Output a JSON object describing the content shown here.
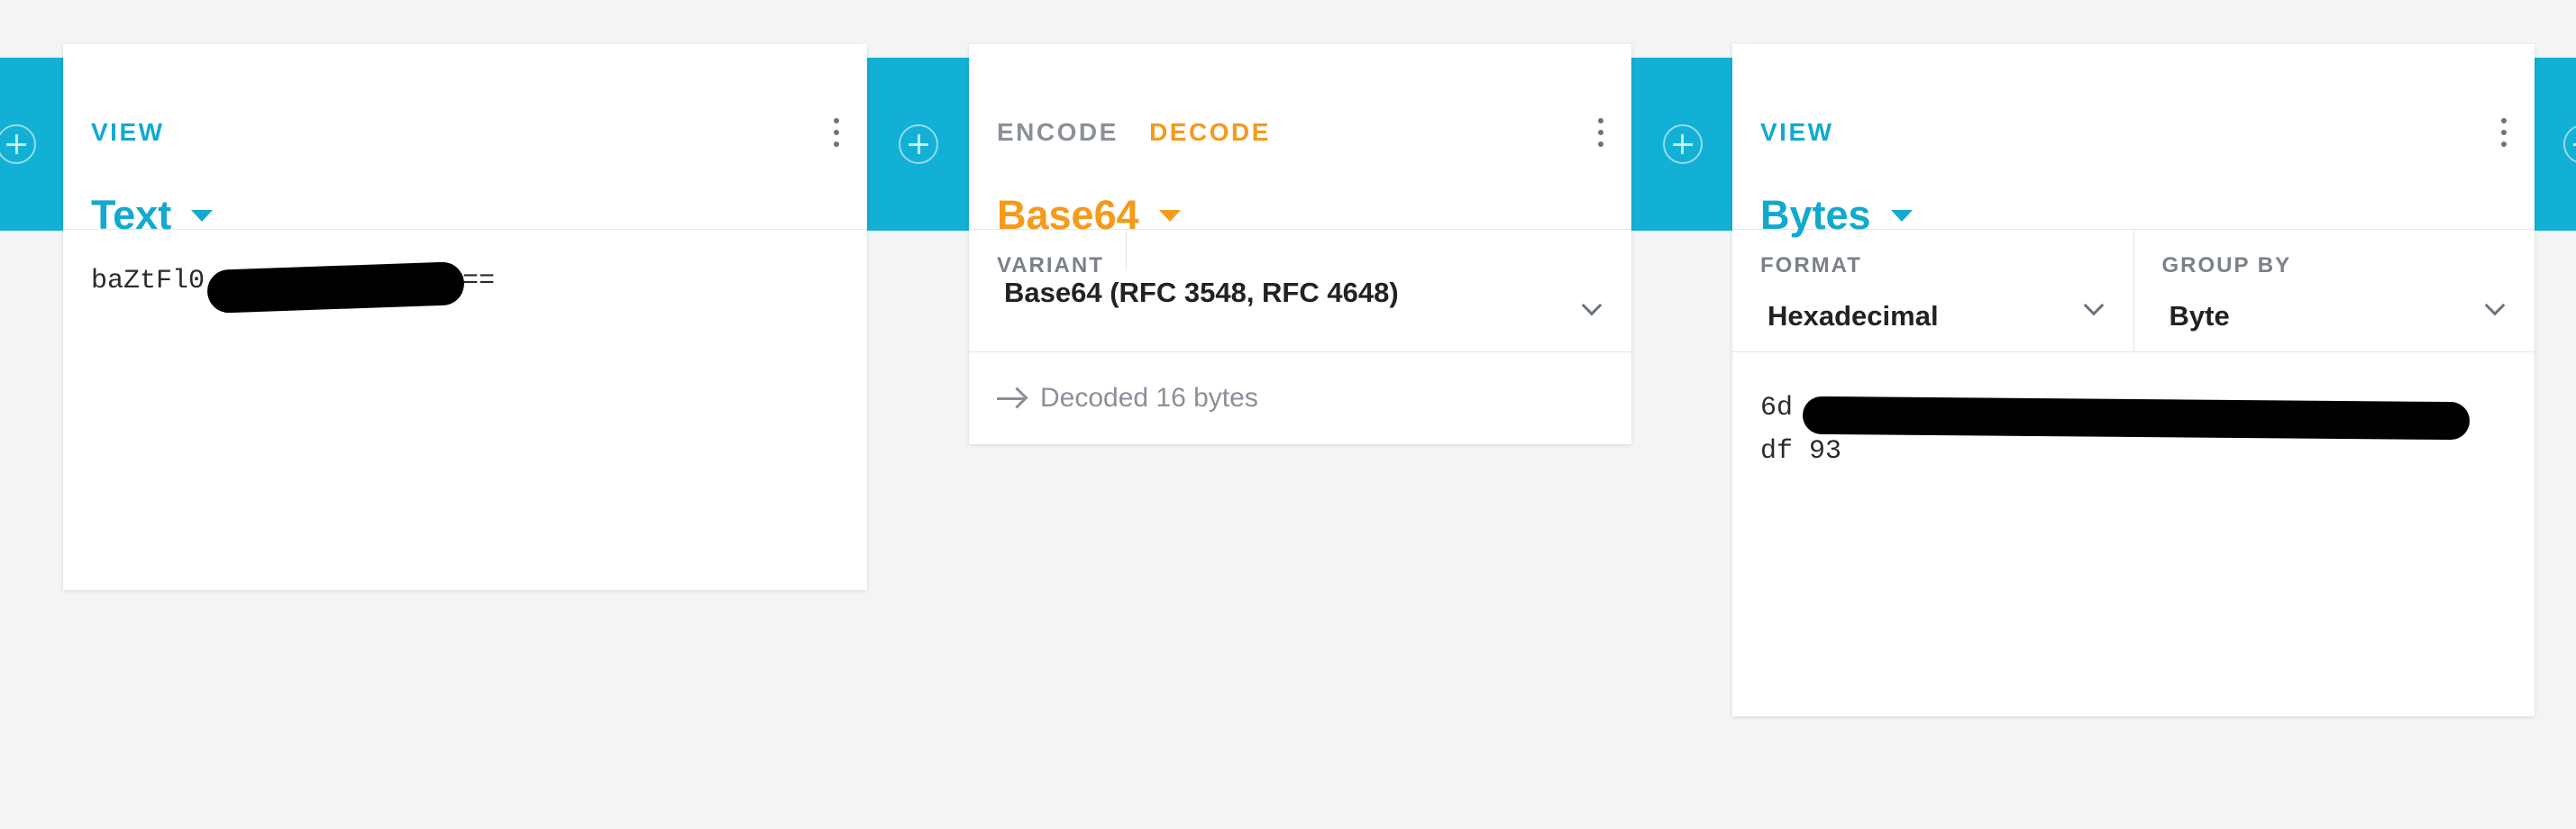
{
  "colors": {
    "accent_cyan": "#13a9cf",
    "accent_orange": "#f59a1b",
    "band": "#12b0d4"
  },
  "card1": {
    "tab": "VIEW",
    "title": "Text",
    "content_start": "baZtFl0",
    "content_end": "zfkw=="
  },
  "card2": {
    "tab_encode": "ENCODE",
    "tab_decode": "DECODE",
    "title": "Base64",
    "variant_label": "VARIANT",
    "variant_value": "Base64 (RFC 3548, RFC 4648)",
    "status": "Decoded 16 bytes"
  },
  "card3": {
    "tab": "VIEW",
    "title": "Bytes",
    "format_label": "FORMAT",
    "format_value": "Hexadecimal",
    "group_label": "GROUP BY",
    "group_value": "Byte",
    "line1_start": "6d",
    "line2": "df 93"
  },
  "icons": [
    "add-circle-icon",
    "kebab-menu-icon",
    "caret-down-icon",
    "chevron-down-icon",
    "arrow-right-icon"
  ]
}
